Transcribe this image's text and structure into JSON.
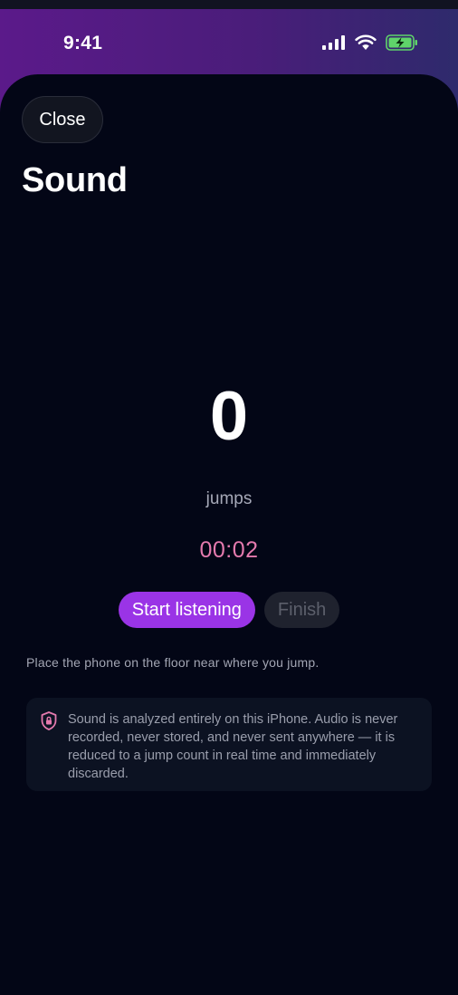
{
  "status_bar": {
    "time": "9:41",
    "icons": [
      "cellular-signal-icon",
      "wifi-icon",
      "battery-charging-icon"
    ]
  },
  "header": {
    "close_label": "Close",
    "title": "Sound"
  },
  "counter": {
    "count": "0",
    "unit": "jumps",
    "elapsed": "00:02"
  },
  "actions": {
    "start_label": "Start listening",
    "finish_label": "Finish",
    "finish_enabled": false
  },
  "hint": "Place the phone on the floor near where you jump.",
  "privacy": {
    "icon": "shield-lock-icon",
    "text": "Sound is analyzed entirely on this iPhone. Audio is never recorded, never stored, and never sent anywhere — it is reduced to a jump count in real time and immediately discarded."
  },
  "colors": {
    "accent": "#9a34e6",
    "timer": "#e57aae",
    "battery": "#5fd46a",
    "background": "#030616"
  }
}
